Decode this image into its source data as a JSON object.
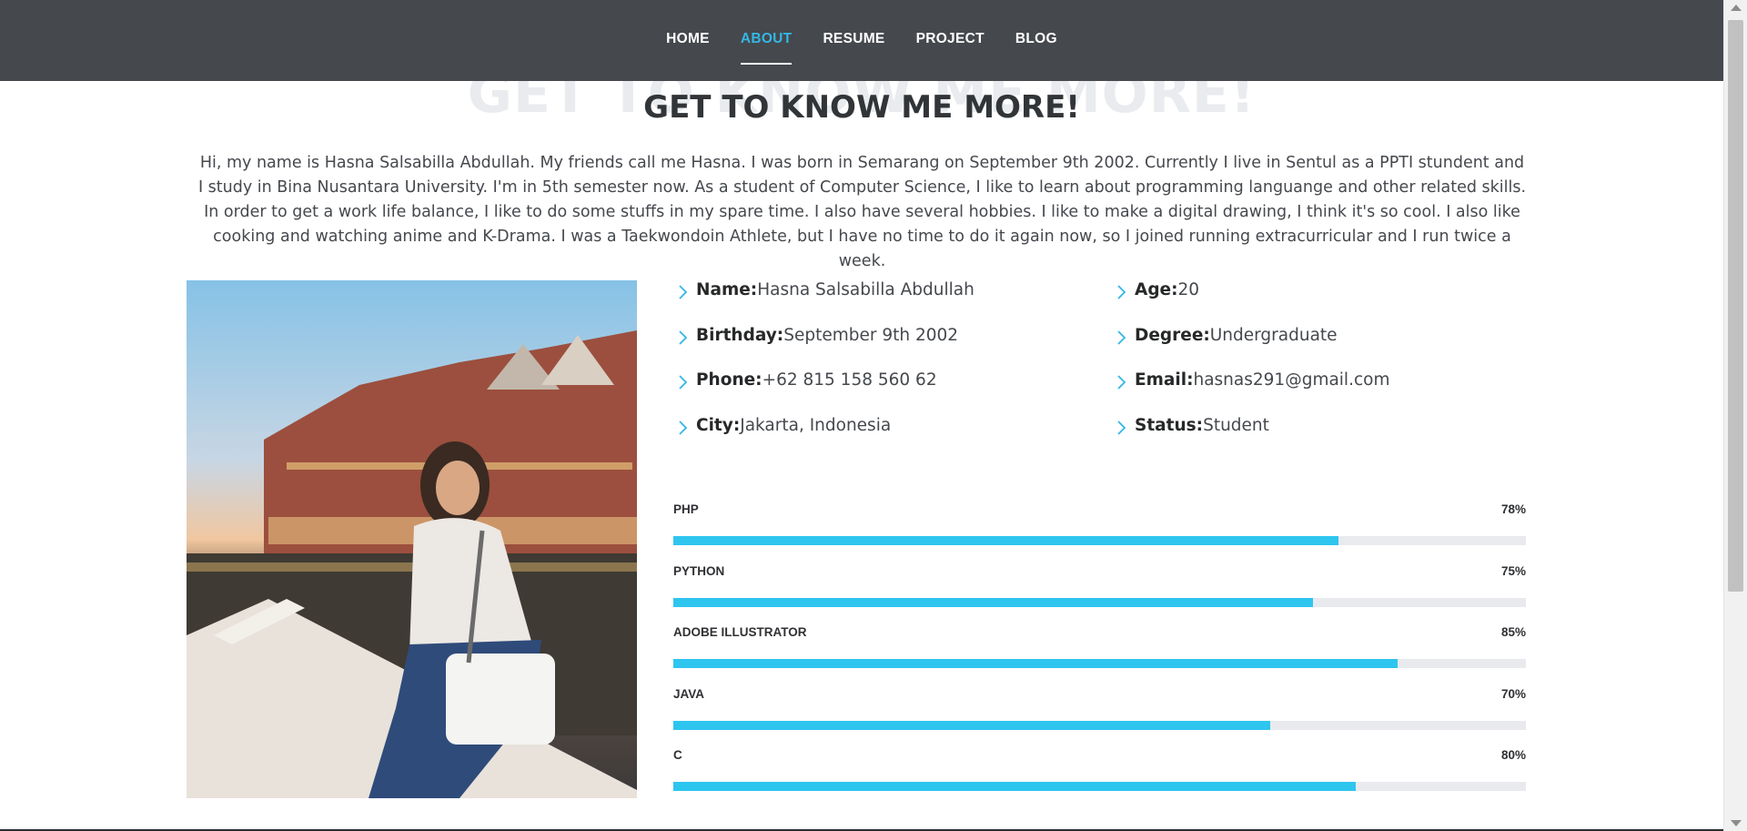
{
  "nav": {
    "items": [
      {
        "label": "HOME",
        "active": false
      },
      {
        "label": "ABOUT",
        "active": true
      },
      {
        "label": "RESUME",
        "active": false
      },
      {
        "label": "PROJECT",
        "active": false
      },
      {
        "label": "BLOG",
        "active": false
      }
    ],
    "active_color": "#34b7e6",
    "bg_color": "#45484d"
  },
  "section": {
    "title_ghost": "GET TO KNOW ME MORE!",
    "title": "GET TO KNOW ME MORE!",
    "intro": "Hi, my name is Hasna Salsabilla Abdullah. My friends call me Hasna. I was born in Semarang on September 9th 2002. Currently I live in Sentul as a PPTI stundent and I study in Bina Nusantara University. I'm in 5th semester now. As a student of Computer Science, I like to learn about programming languange and other related skills. In order to get a work life balance, I like to do some stuffs in my spare time. I also have several hobbies. I like to make a digital drawing, I think it's so cool. I also like cooking and watching anime and K-Drama. I was a Taekwondoin Athlete, but I have no time to do it again now, so I joined running extracurricular and I run twice a week."
  },
  "info": {
    "left": [
      {
        "label": "Name:",
        "value": "Hasna Salsabilla Abdullah"
      },
      {
        "label": "Birthday:",
        "value": "September 9th 2002"
      },
      {
        "label": "Phone:",
        "value": "+62 815 158 560 62"
      },
      {
        "label": "City:",
        "value": "Jakarta, Indonesia"
      }
    ],
    "right": [
      {
        "label": "Age:",
        "value": "20"
      },
      {
        "label": "Degree:",
        "value": "Undergraduate"
      },
      {
        "label": "Email:",
        "value": "hasnas291@gmail.com"
      },
      {
        "label": "Status:",
        "value": "Student"
      }
    ]
  },
  "skills": [
    {
      "name": "PHP",
      "value_label": "78%",
      "percent": 78
    },
    {
      "name": "PYTHON",
      "value_label": "75%",
      "percent": 75
    },
    {
      "name": "ADOBE ILLUSTRATOR",
      "value_label": "85%",
      "percent": 85
    },
    {
      "name": "JAVA",
      "value_label": "70%",
      "percent": 70
    },
    {
      "name": "C",
      "value_label": "80%",
      "percent": 80
    }
  ],
  "colors": {
    "accent": "#2ec5ef",
    "track": "#e8eaee"
  },
  "icons": {
    "bullet": "chevron-right-icon",
    "photo": "profile-photo"
  }
}
